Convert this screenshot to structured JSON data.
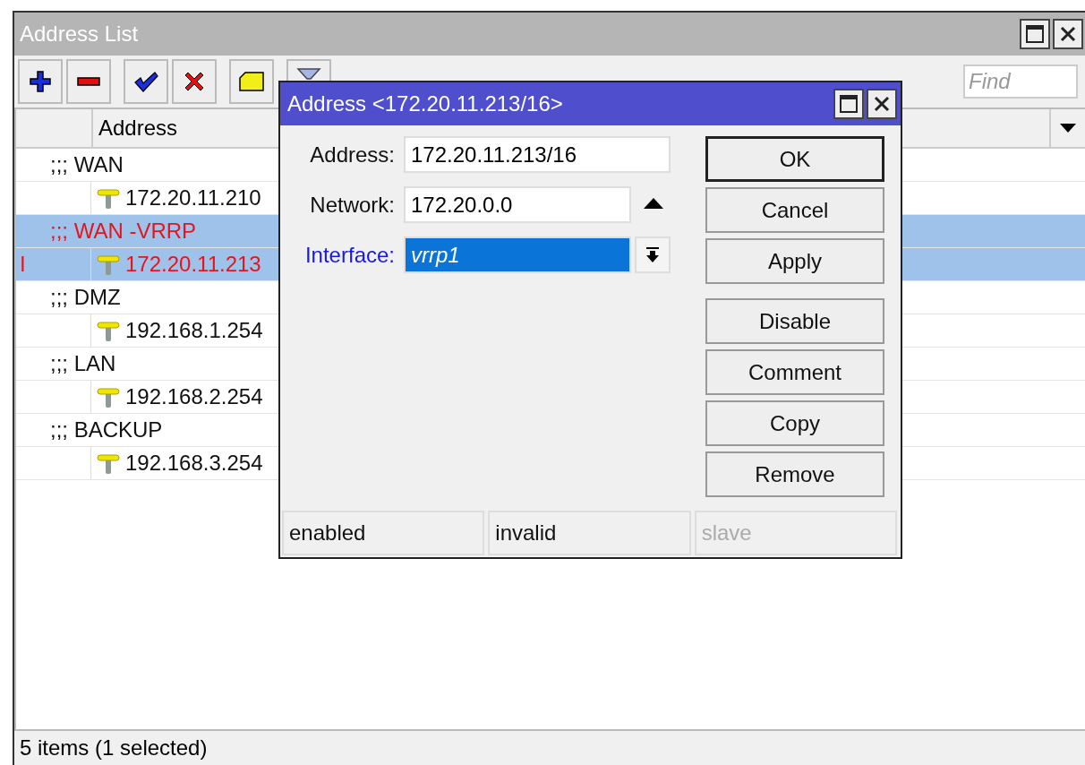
{
  "window": {
    "title": "Address List"
  },
  "find": {
    "placeholder": "Find"
  },
  "table": {
    "columns": [
      "Address"
    ],
    "rows": [
      {
        "kind": "comment",
        "text": ";;; WAN",
        "selected": false,
        "invalid": false
      },
      {
        "kind": "address",
        "text": "172.20.11.210",
        "selected": false,
        "invalid": false
      },
      {
        "kind": "comment",
        "text": ";;; WAN -VRRP",
        "selected": true,
        "invalid": true
      },
      {
        "kind": "address",
        "flag": "I",
        "text": "172.20.11.213",
        "selected": true,
        "invalid": true
      },
      {
        "kind": "comment",
        "text": ";;; DMZ",
        "selected": false,
        "invalid": false
      },
      {
        "kind": "address",
        "text": "192.168.1.254",
        "selected": false,
        "invalid": false
      },
      {
        "kind": "comment",
        "text": ";;; LAN",
        "selected": false,
        "invalid": false
      },
      {
        "kind": "address",
        "text": "192.168.2.254",
        "selected": false,
        "invalid": false
      },
      {
        "kind": "comment",
        "text": ";;; BACKUP",
        "selected": false,
        "invalid": false
      },
      {
        "kind": "address",
        "text": "192.168.3.254",
        "selected": false,
        "invalid": false
      }
    ]
  },
  "status_bar": "5 items (1 selected)",
  "dialog": {
    "title": "Address <172.20.11.213/16>",
    "fields": [
      {
        "kind": "text",
        "label": "Address:",
        "value": "172.20.11.213/16",
        "highlighted": false
      },
      {
        "kind": "toggle",
        "label": "Network:",
        "value": "172.20.0.0",
        "highlighted": false
      },
      {
        "kind": "dropdown",
        "label": "Interface:",
        "value": "vrrp1",
        "highlighted": true
      }
    ],
    "buttons": [
      {
        "label": "OK",
        "default": true
      },
      {
        "label": "Cancel",
        "default": false
      },
      {
        "label": "Apply",
        "default": false
      },
      {
        "label": "Disable",
        "default": false
      },
      {
        "label": "Comment",
        "default": false
      },
      {
        "label": "Copy",
        "default": false
      },
      {
        "label": "Remove",
        "default": false
      }
    ],
    "status": [
      {
        "text": "enabled",
        "disabled": false
      },
      {
        "text": "invalid",
        "disabled": false
      },
      {
        "text": "slave",
        "disabled": true
      }
    ]
  }
}
